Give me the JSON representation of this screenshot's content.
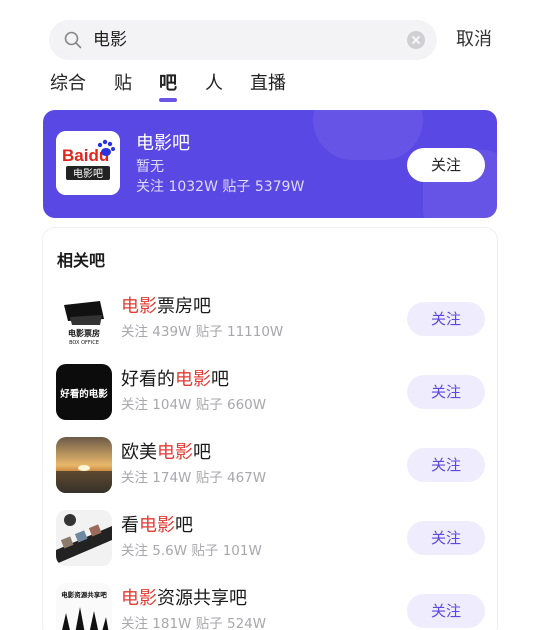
{
  "search": {
    "query": "电影",
    "cancel_label": "取消"
  },
  "tabs": [
    {
      "label": "综合"
    },
    {
      "label": "贴"
    },
    {
      "label": "吧"
    },
    {
      "label": "人"
    },
    {
      "label": "直播"
    }
  ],
  "active_tab": "吧",
  "hero": {
    "name": "电影吧",
    "subtitle": "暂无",
    "stats": "关注 1032W   贴子 5379W",
    "follow_label": "关注",
    "logo_text": "Baidu",
    "logo_caption": "电影吧"
  },
  "related": {
    "title": "相关吧",
    "items": [
      {
        "name_parts": [
          "电影",
          "票房吧"
        ],
        "highlight_first": true,
        "stats": "关注 439W 贴子 11110W",
        "follow_label": "关注",
        "thumb_text": "电影票房",
        "thumb_sub": "BOX OFFICE"
      },
      {
        "name_parts": [
          "好看的",
          "电影",
          "吧"
        ],
        "highlight_index": 1,
        "stats": "关注 104W 贴子 660W",
        "follow_label": "关注",
        "thumb_text": "好看的电影"
      },
      {
        "name_parts": [
          "欧美",
          "电影",
          "吧"
        ],
        "highlight_index": 1,
        "stats": "关注 174W 贴子 467W",
        "follow_label": "关注"
      },
      {
        "name_parts": [
          "看",
          "电影",
          "吧"
        ],
        "highlight_index": 1,
        "stats": "关注 5.6W 贴子 101W",
        "follow_label": "关注"
      },
      {
        "name_parts": [
          "电影",
          "资源共享吧"
        ],
        "highlight_first": true,
        "stats": "关注 181W 贴子 524W",
        "follow_label": "关注",
        "thumb_text": "电影资源共享吧"
      }
    ]
  },
  "colors": {
    "accent": "#5a48e4",
    "highlight": "#e23b32",
    "follow_bg": "#efedfd"
  }
}
